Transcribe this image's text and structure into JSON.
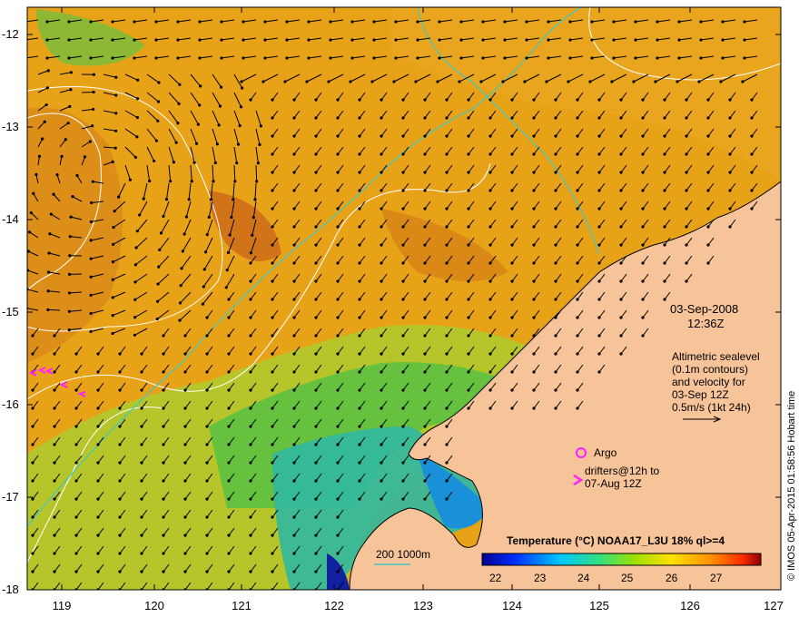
{
  "map": {
    "lat_ticks": [
      "-12",
      "-13",
      "-14",
      "-15",
      "-16",
      "-17",
      "-18"
    ],
    "lon_ticks": [
      "119",
      "120",
      "121",
      "122",
      "123",
      "124",
      "125",
      "126",
      "127"
    ],
    "date": "03-Sep-2008",
    "time": "12:36Z",
    "sealevel_note": [
      "Altimetric sealevel",
      "(0.1m contours)",
      "and velocity for",
      "03-Sep 12Z",
      "0.5m/s (1kt 24h)"
    ],
    "argo_label": "Argo",
    "drifters_label": [
      "drifters@12h to",
      "07-Aug 12Z"
    ],
    "drifter_symbol": ">",
    "depth_label": "200  1000m",
    "colorbar_title": "Temperature (°C) NOAA17_L3U 18% ql>=4",
    "colorbar_ticks": [
      "22",
      "23",
      "24",
      "25",
      "26",
      "27"
    ],
    "credit": "© IMOS 05-Apr-2015 01:58:56 Hobart time"
  },
  "colors": {
    "land": "#f7c49a",
    "sst_warm": "#e59a12",
    "sst_hot": "#c45a10",
    "sst_green": "#8ccc28",
    "sst_cool": "#1aa8c8",
    "contour": "#ffffff",
    "bathymetry": "#40c8c0",
    "marker": "#ff22ff"
  }
}
